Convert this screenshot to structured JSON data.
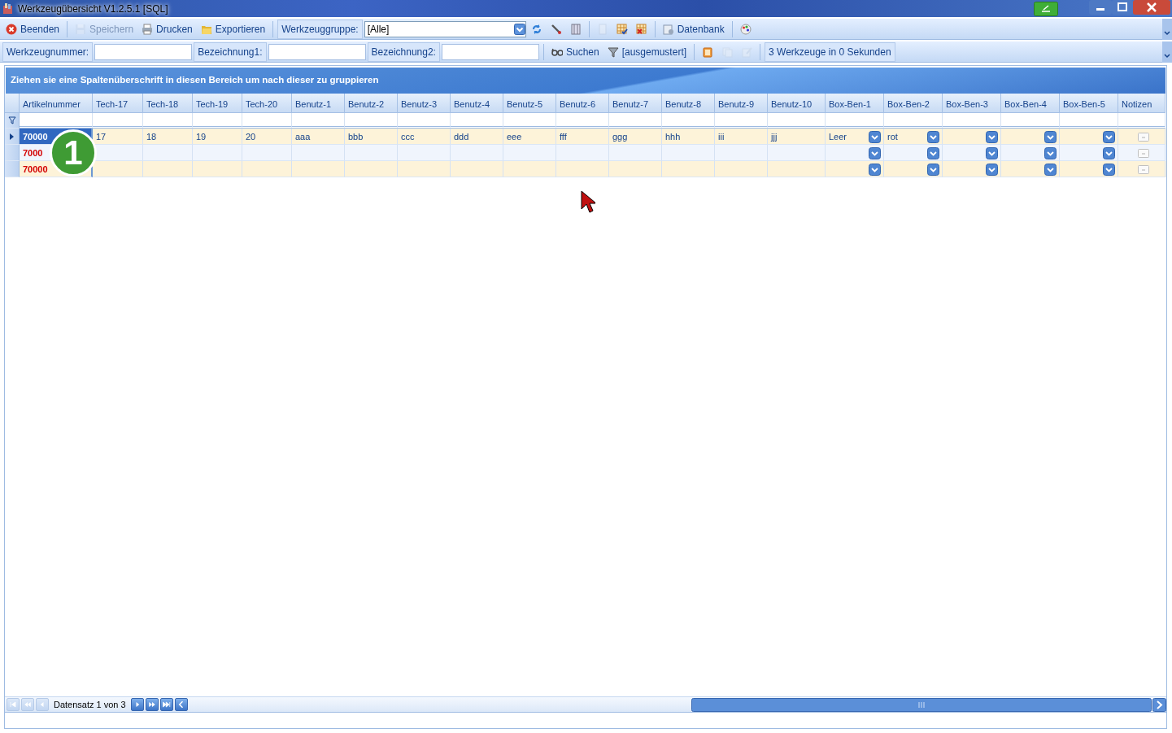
{
  "window": {
    "title": "Werkzeugübersicht V1.2.5.1 [SQL]"
  },
  "toolbar": [
    {
      "kind": "button",
      "label": "Beenden",
      "disabled": false
    },
    {
      "kind": "separator"
    },
    {
      "kind": "button",
      "label": "Speichern",
      "disabled": true
    },
    {
      "kind": "button",
      "label": "Drucken",
      "disabled": false
    },
    {
      "kind": "button",
      "label": "Exportieren",
      "disabled": false
    },
    {
      "kind": "separator"
    },
    {
      "kind": "label",
      "label": "Werkzeuggruppe:"
    },
    {
      "kind": "select",
      "value": "[Alle]"
    },
    {
      "kind": "icon",
      "disabled": false
    },
    {
      "kind": "icon",
      "disabled": false
    },
    {
      "kind": "icon",
      "disabled": false
    },
    {
      "kind": "separator"
    },
    {
      "kind": "icon",
      "disabled": true
    },
    {
      "kind": "icon",
      "disabled": false
    },
    {
      "kind": "icon",
      "disabled": false
    },
    {
      "kind": "separator"
    },
    {
      "kind": "button",
      "label": "Datenbank",
      "disabled": false
    },
    {
      "kind": "separator"
    },
    {
      "kind": "icon",
      "disabled": false
    }
  ],
  "search_bar": [
    {
      "kind": "label",
      "label": "Werkzeugnummer:"
    },
    {
      "kind": "field"
    },
    {
      "kind": "label",
      "label": "Bezeichnung1:"
    },
    {
      "kind": "field"
    },
    {
      "kind": "label",
      "label": "Bezeichnung2:"
    },
    {
      "kind": "field"
    },
    {
      "kind": "separator"
    },
    {
      "kind": "button",
      "label": "Suchen",
      "disabled": false
    },
    {
      "kind": "button",
      "label": "[ausgemustert]",
      "disabled": false
    },
    {
      "kind": "separator"
    },
    {
      "kind": "icon",
      "disabled": false
    },
    {
      "kind": "icon",
      "disabled": true
    },
    {
      "kind": "icon",
      "disabled": true
    },
    {
      "kind": "separator"
    },
    {
      "kind": "status",
      "label": "3 Werkzeuge in 0 Sekunden"
    }
  ],
  "grid": {
    "group_hint": "Ziehen sie eine Spaltenüberschrift in diesen Bereich um nach dieser zu gruppieren",
    "columns": [
      {
        "label": "Artikelnummer",
        "kind": "key"
      },
      {
        "label": "Tech-17",
        "kind": "text"
      },
      {
        "label": "Tech-18",
        "kind": "text"
      },
      {
        "label": "Tech-19",
        "kind": "text"
      },
      {
        "label": "Tech-20",
        "kind": "text"
      },
      {
        "label": "Benutz-1",
        "kind": "text"
      },
      {
        "label": "Benutz-2",
        "kind": "text"
      },
      {
        "label": "Benutz-3",
        "kind": "text"
      },
      {
        "label": "Benutz-4",
        "kind": "text"
      },
      {
        "label": "Benutz-5",
        "kind": "text"
      },
      {
        "label": "Benutz-6",
        "kind": "text"
      },
      {
        "label": "Benutz-7",
        "kind": "text"
      },
      {
        "label": "Benutz-8",
        "kind": "text"
      },
      {
        "label": "Benutz-9",
        "kind": "text"
      },
      {
        "label": "Benutz-10",
        "kind": "text"
      },
      {
        "label": "Box-Ben-1",
        "kind": "combo"
      },
      {
        "label": "Box-Ben-2",
        "kind": "combo"
      },
      {
        "label": "Box-Ben-3",
        "kind": "combo"
      },
      {
        "label": "Box-Ben-4",
        "kind": "combo"
      },
      {
        "label": "Box-Ben-5",
        "kind": "combo"
      },
      {
        "label": "Notizen",
        "kind": "note"
      }
    ],
    "rows": [
      {
        "selected": true,
        "article": "70000",
        "values": [
          "17",
          "18",
          "19",
          "20",
          "aaa",
          "bbb",
          "ccc",
          "ddd",
          "eee",
          "fff",
          "ggg",
          "hhh",
          "iii",
          "jjj",
          "Leer",
          "rot"
        ]
      },
      {
        "selected": false,
        "article": "7000"
      },
      {
        "selected": false,
        "article": "70000"
      }
    ],
    "callout": {
      "label": "1"
    },
    "pager": {
      "text": "Datensatz 1 von 3",
      "buttons": [
        {
          "kind": "first",
          "disabled": true
        },
        {
          "kind": "prev-page",
          "disabled": true
        },
        {
          "kind": "prev",
          "disabled": true
        },
        {
          "kind": "next",
          "disabled": false
        },
        {
          "kind": "next-page",
          "disabled": false
        },
        {
          "kind": "last",
          "disabled": false
        },
        {
          "kind": "back",
          "disabled": false
        }
      ]
    }
  }
}
